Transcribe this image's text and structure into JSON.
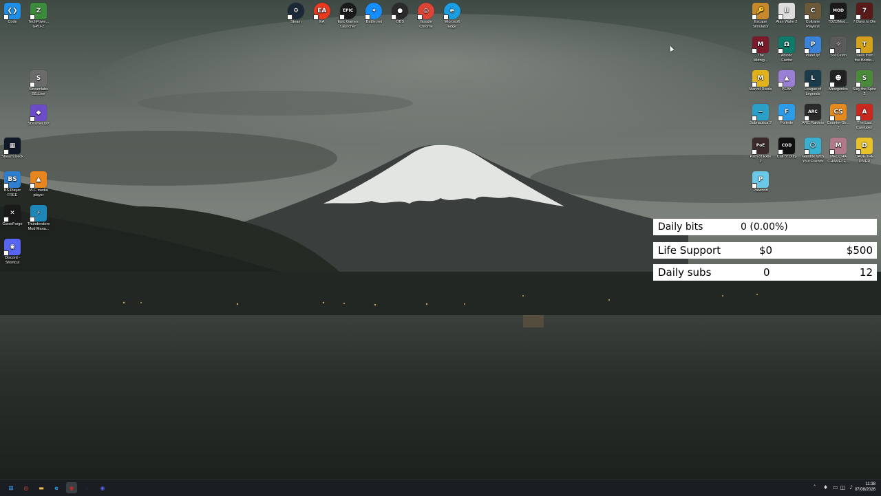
{
  "desktop": {
    "icons_left": [
      {
        "label": "Code",
        "icon": "vscode-icon",
        "color": "#1f8fe6",
        "glyph": "❮❯"
      },
      {
        "label": "TechPowe...\nGPU-Z",
        "icon": "gpuz-icon",
        "color": "#3c8a3c",
        "glyph": "Z"
      },
      {
        "label": "Streamlabs\nSE.Live",
        "icon": "streamlabs-icon",
        "color": "#6b6b6b",
        "glyph": "S"
      },
      {
        "label": "Streamer.bot",
        "icon": "streamerbot-icon",
        "color": "#6d4cc9",
        "glyph": "◆"
      },
      {
        "label": "Stream Deck",
        "icon": "streamdeck-icon",
        "color": "#111827",
        "glyph": "▦"
      },
      {
        "label": "BS.Player\nFREE",
        "icon": "bsplayer-icon",
        "color": "#2f7fd0",
        "glyph": "BS"
      },
      {
        "label": "VLC media\nplayer",
        "icon": "vlc-icon",
        "color": "#e8861d",
        "glyph": "▲"
      },
      {
        "label": "CurseForge",
        "icon": "curseforge-icon",
        "color": "#1a1a1a",
        "glyph": "✕"
      },
      {
        "label": "Thunderstore\nMod Mana...",
        "icon": "thunderstore-icon",
        "color": "#1e87b8",
        "glyph": "⚡"
      },
      {
        "label": "Discord -\nShortcut",
        "icon": "discord-icon",
        "color": "#5865f2",
        "glyph": "◉"
      }
    ],
    "icons_top": [
      {
        "label": "Steam",
        "icon": "steam-icon",
        "color": "#1b2838",
        "glyph": "⚙"
      },
      {
        "label": "EA",
        "icon": "ea-icon",
        "color": "#e9391f",
        "glyph": "EA"
      },
      {
        "label": "Epic Games\nLauncher",
        "icon": "epic-games-icon",
        "color": "#1a1a1a",
        "glyph": "EPIC"
      },
      {
        "label": "Battle.net",
        "icon": "battlenet-icon",
        "color": "#148eff",
        "glyph": "✦"
      },
      {
        "label": "OBS",
        "icon": "obs-icon",
        "color": "#2b2b2b",
        "glyph": "●"
      },
      {
        "label": "Google\nChrome",
        "icon": "chrome-icon",
        "color": "#db4437",
        "glyph": "◎"
      },
      {
        "label": "Microsoft\nEdge",
        "icon": "edge-icon",
        "color": "#1b9de2",
        "glyph": "e"
      }
    ],
    "icons_right": [
      {
        "label": "Escape\nSimulator",
        "icon": "escape-simulator-icon",
        "color": "#c7892a",
        "glyph": "🔑"
      },
      {
        "label": "Alan Wake 2",
        "icon": "alan-wake-2-icon",
        "color": "#ddd",
        "glyph": "II"
      },
      {
        "label": "Coltrane\nPlaytest",
        "icon": "coltrane-icon",
        "color": "#6b5a3a",
        "glyph": "C"
      },
      {
        "label": "7DZDMod...",
        "icon": "mod-launcher-icon",
        "color": "#1a1a1a",
        "glyph": "MOD"
      },
      {
        "label": "7 Days to Die",
        "icon": "7-days-to-die-icon",
        "color": "#5a1a1a",
        "glyph": "7"
      },
      {
        "label": "The\nMidnig...",
        "icon": "midnight-icon",
        "color": "#7a1a2a",
        "glyph": "M"
      },
      {
        "label": "Abiotic\nFactor",
        "icon": "abiotic-factor-icon",
        "color": "#0e7a6a",
        "glyph": "Ω"
      },
      {
        "label": "PlateUp!",
        "icon": "plateup-icon",
        "color": "#3b83d9",
        "glyph": "P"
      },
      {
        "label": "Sol Cesto",
        "icon": "sol-cesto-icon",
        "color": "#5a5a5a",
        "glyph": "☼"
      },
      {
        "label": "Tales from\nthe Borde...",
        "icon": "tales-borderlands-icon",
        "color": "#d4a21a",
        "glyph": "T"
      },
      {
        "label": "Marvel Rivals",
        "icon": "marvel-rivals-icon",
        "color": "#e2b21c",
        "glyph": "M"
      },
      {
        "label": "PEAK",
        "icon": "peak-icon",
        "color": "#9b7fd4",
        "glyph": "▲"
      },
      {
        "label": "League of\nLegends",
        "icon": "league-icon",
        "color": "#1c3b4a",
        "glyph": "L"
      },
      {
        "label": "Mewgenics",
        "icon": "mewgenics-icon",
        "color": "#222",
        "glyph": "☻"
      },
      {
        "label": "Slay the Spire\n2",
        "icon": "slay-the-spire-icon",
        "color": "#4a8a3a",
        "glyph": "S"
      },
      {
        "label": "Subnautica 2",
        "icon": "subnautica-icon",
        "color": "#2aa0c8",
        "glyph": "~"
      },
      {
        "label": "Fortnite",
        "icon": "fortnite-icon",
        "color": "#2c9be8",
        "glyph": "F"
      },
      {
        "label": "ARC Raiders",
        "icon": "arc-raiders-icon",
        "color": "#2a2a2a",
        "glyph": "ARC"
      },
      {
        "label": "Counter-Str...\n2",
        "icon": "counter-strike-icon",
        "color": "#e58a1f",
        "glyph": "CS"
      },
      {
        "label": "The Last\nCaretaker",
        "icon": "last-caretaker-icon",
        "color": "#c8281e",
        "glyph": "A"
      },
      {
        "label": "Path of Exile\n2",
        "icon": "path-of-exile-icon",
        "color": "#3a2a2a",
        "glyph": "PoE"
      },
      {
        "label": "Call of Duty",
        "icon": "call-of-duty-icon",
        "color": "#111",
        "glyph": "COD"
      },
      {
        "label": "Gamble With\nYour Friends",
        "icon": "gamble-icon",
        "color": "#3ab0d0",
        "glyph": "☺"
      },
      {
        "label": "MECCHA\nCHAMELE...",
        "icon": "meccha-icon",
        "color": "#b07a8a",
        "glyph": "M"
      },
      {
        "label": "DAVE THE\nDIVER",
        "icon": "dave-the-diver-icon",
        "color": "#e8c22a",
        "glyph": "D"
      },
      {
        "label": "Palworld",
        "icon": "palworld-icon",
        "color": "#6ac8e8",
        "glyph": "P"
      }
    ]
  },
  "widget": {
    "daily_bits": {
      "label": "Daily bits",
      "value": "0 (0.00%)"
    },
    "life_support": {
      "label": "Life Support",
      "current": "$0",
      "goal": "$500"
    },
    "daily_subs": {
      "label": "Daily subs",
      "current": "0",
      "goal": "12"
    }
  },
  "taskbar": {
    "pinned": [
      {
        "icon": "windows-start-icon",
        "color": "#3aa0ff",
        "glyph": "⊞"
      },
      {
        "icon": "chrome-icon",
        "color": "#db4437",
        "glyph": "◎"
      },
      {
        "icon": "file-explorer-icon",
        "color": "#f2c14e",
        "glyph": "▬"
      },
      {
        "icon": "edge-icon",
        "color": "#1b9de2",
        "glyph": "e"
      },
      {
        "icon": "app-active-icon",
        "color": "#c8281e",
        "glyph": "◉"
      },
      {
        "icon": "steam-icon",
        "color": "#1b2838",
        "glyph": "⚙"
      },
      {
        "icon": "discord-icon",
        "color": "#5865f2",
        "glyph": "◉"
      }
    ],
    "clock_time": "11:38",
    "clock_date": "07/08/2026"
  }
}
